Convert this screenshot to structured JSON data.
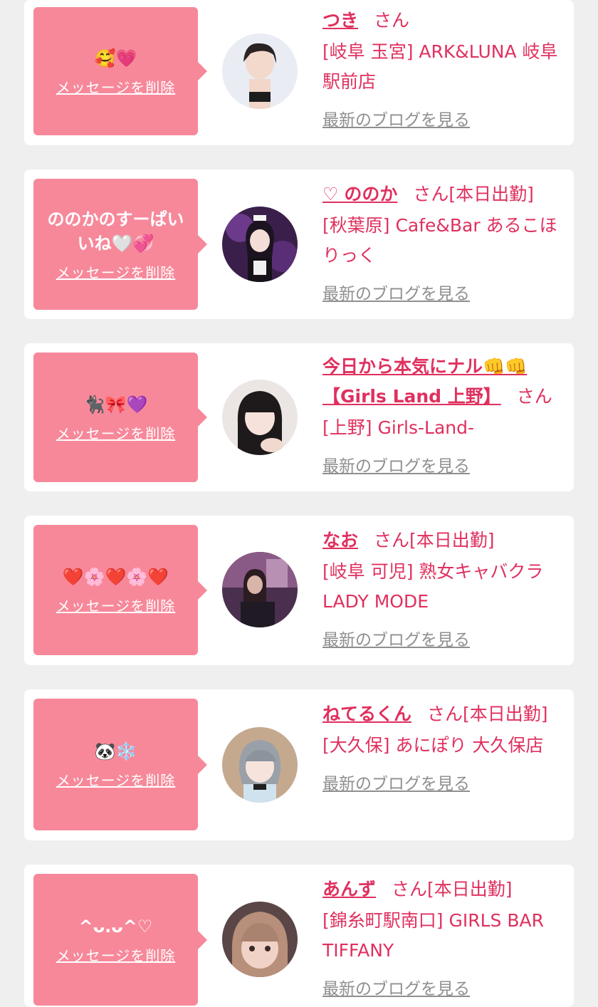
{
  "common": {
    "delete_label": "メッセージを削除",
    "blog_label": "最新のブログを見る",
    "san": "さん",
    "on_duty": "[本日出勤]"
  },
  "entries": [
    {
      "name": "つき",
      "heart": "",
      "message": "🥰💗",
      "shop": "[岐阜 玉宮] ARK&LUNA 岐阜駅前店",
      "on_duty": false,
      "avatar_icon": "photo-avatar-icon"
    },
    {
      "name": "ののか",
      "heart": "♡ ",
      "message": "ののかのすーぱいいね🤍💞",
      "shop": "[秋葉原] Cafe&Bar あるこほりっく",
      "on_duty": true,
      "avatar_icon": "photo-avatar-icon"
    },
    {
      "name": "今日から本気にナル👊👊【Girls Land 上野】",
      "heart": "",
      "message": "🐈‍⬛🎀💜",
      "shop": "[上野] Girls-Land-",
      "on_duty": false,
      "avatar_icon": "photo-avatar-icon"
    },
    {
      "name": "なお",
      "heart": "",
      "message": "❤️🌸❤️🌸❤️",
      "shop": "[岐阜 可児] 熟女キャバクラ LADY MODE",
      "on_duty": true,
      "avatar_icon": "photo-avatar-icon"
    },
    {
      "name": "ねてるくん",
      "heart": "",
      "message": "🐼❄️",
      "shop": "[大久保] あにぽり 大久保店",
      "on_duty": true,
      "avatar_icon": "photo-avatar-icon"
    },
    {
      "name": "あんず",
      "heart": "",
      "message": "^ᴗ.ᴗ^♡",
      "shop": "[錦糸町駅南口] GIRLS BAR TIFFANY",
      "on_duty": true,
      "avatar_icon": "photo-avatar-icon"
    }
  ],
  "colors": {
    "accent": "#e0305e",
    "bubble": "#f7889a",
    "background": "#f0efef",
    "link_gray": "#8f8f8f"
  }
}
